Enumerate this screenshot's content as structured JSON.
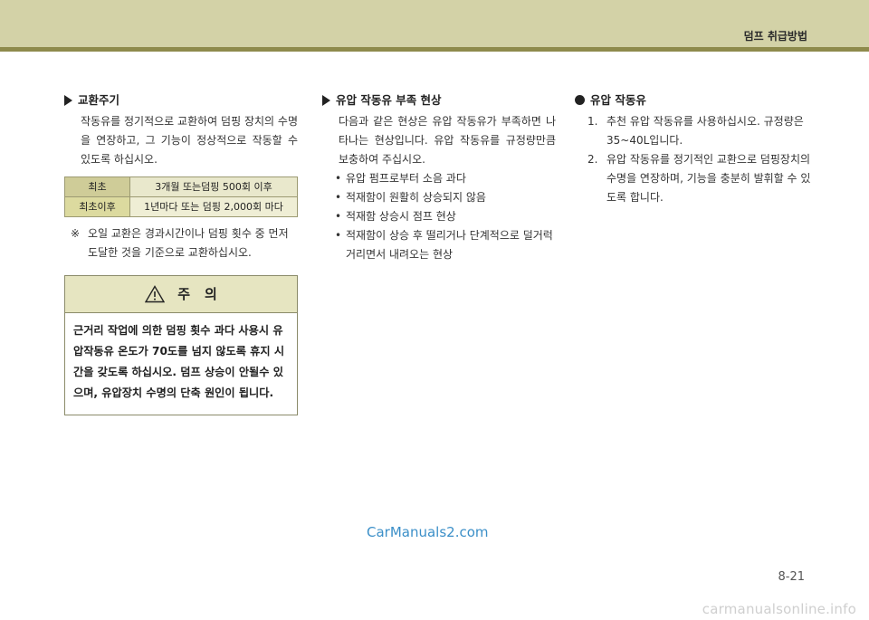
{
  "header": {
    "title": "덤프 취급방법"
  },
  "left": {
    "title": "교환주기",
    "paragraph": "작동유를 정기적으로 교환하여 덤핑 장치의 수명을 연장하고, 그 기능이 정상적으로 작동할 수 있도록 하십시오.",
    "table": [
      {
        "label": "최초",
        "value": "3개월 또는덤핑 500회 이후"
      },
      {
        "label": "최초이후",
        "value": "1년마다 또는 덤핑 2,000회 마다"
      }
    ],
    "note_mark": "※",
    "note": "오일 교환은 경과시간이나 덤핑 횟수 중 먼저 도달한 것을 기준으로 교환하십시오.",
    "caution": {
      "title": "주의",
      "body": "근거리 작업에 의한 덤핑 횟수 과다 사용시 유압작동유 온도가 70도를 넘지 않도록 휴지 시간을 갖도록 하십시오. 덤프 상승이 안될수 있으며, 유압장치 수명의 단축 원인이 됩니다."
    }
  },
  "middle": {
    "title": "유압 작동유 부족 현상",
    "paragraph": "다음과 같은 현상은 유압 작동유가 부족하면 나타나는 현상입니다. 유압 작동유를 규정량만큼 보충하여 주십시오.",
    "bullets": [
      "유압 펌프로부터 소음 과다",
      "적재함이 원활히 상승되지 않음",
      "적재함 상승시 점프 현상",
      "적재함이 상승 후 떨리거나 단계적으로 덜거럭 거리면서 내려오는 현상"
    ]
  },
  "right": {
    "title": "유압 작동유",
    "steps": [
      {
        "num": "1.",
        "text": "추천 유압 작동유를 사용하십시오. 규정량은 35~40L입니다."
      },
      {
        "num": "2.",
        "text": "유압 작동유를 정기적인 교환으로 덤핑장치의 수명을 연장하며, 기능을 충분히 발휘할 수 있도록 합니다."
      }
    ]
  },
  "watermark": "CarManuals2.com",
  "page_number": "8-21",
  "footer_site": "carmanualsonline.info"
}
